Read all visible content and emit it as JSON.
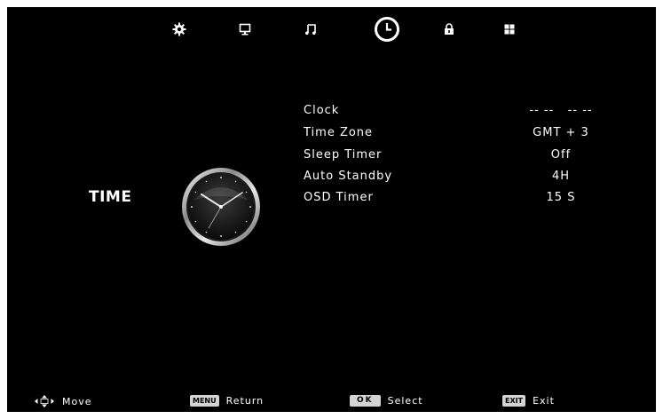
{
  "tabs": [
    {
      "name": "picture",
      "icon": "gear-icon"
    },
    {
      "name": "screen",
      "icon": "monitor-icon"
    },
    {
      "name": "sound",
      "icon": "music-note-icon"
    },
    {
      "name": "time",
      "icon": "clock-icon",
      "active": true
    },
    {
      "name": "lock",
      "icon": "padlock-icon"
    },
    {
      "name": "setup",
      "icon": "grid-icon"
    }
  ],
  "section": {
    "title": "TIME",
    "art_icon": "analog-clock-icon"
  },
  "menu": {
    "items": [
      {
        "label": "Clock",
        "value": "-- --   -- --"
      },
      {
        "label": "Time Zone",
        "value": "GMT + 3"
      },
      {
        "label": "Sleep Timer",
        "value": "Off"
      },
      {
        "label": "Auto Standby",
        "value": "4H"
      },
      {
        "label": "OSD Timer",
        "value": "15 S"
      }
    ]
  },
  "footer": {
    "move": {
      "label": "Move",
      "icon": "navigation-arrows-icon"
    },
    "return": {
      "key": "MENU",
      "label": "Return"
    },
    "select": {
      "key": "OK",
      "label": "Select"
    },
    "exit": {
      "key": "EXIT",
      "label": "Exit"
    }
  },
  "colors": {
    "background": "#000000",
    "text": "#ffffff",
    "key_badge": "#d4d4d4",
    "page_border": "#ffffff"
  }
}
